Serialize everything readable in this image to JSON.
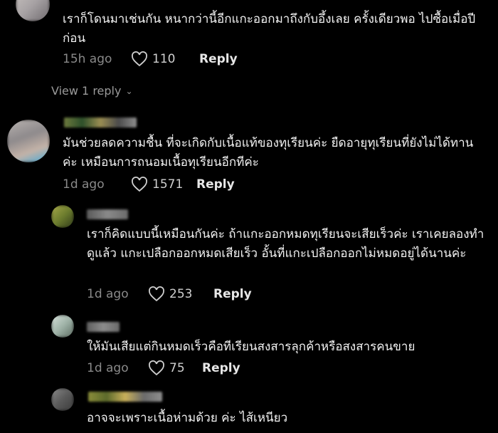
{
  "comments": [
    {
      "text": "เราก็โดนมาเช่นกัน หนากว่านี้อีกแกะออกมาถึงกับอึ้งเลย ครั้งเดียวพอ ไปซื้อเมื่อปีก่อน",
      "time": "15h ago",
      "likes": "110",
      "reply": "Reply"
    },
    {
      "text": "มันช่วยลดความชื้น ที่จะเกิดกับเนื้อแท้ของทุเรียนค่ะ ยืดอายุทุเรียนที่ยังไม่ได้ทาน ค่ะ เหมือนการถนอมเนื้อทุเรียนอีกทีค่ะ",
      "time": "1d ago",
      "likes": "1571",
      "reply": "Reply"
    },
    {
      "text": "เราก็คิดแบบนี้เหมือนกันค่ะ ถ้าแกะออกหมดทุเรียนจะเสียเร็วค่ะ เราเคยลองทำดูแล้ว แกะเปลือกออกหมดเสียเร็ว อั้นที่แกะเปลือกออกไม่หมดอยู่ได้นานค่ะ",
      "time": "1d ago",
      "likes": "253",
      "reply": "Reply"
    },
    {
      "text": "ให้มันเสียแต่กินหมดเร็วคือทีเรียนสงสารลุกค้าหรือสงสารคนขาย",
      "time": "1d ago",
      "likes": "75",
      "reply": "Reply"
    },
    {
      "text": "อาจจะเพราะเนื้อห่ามด้วย ค่ะ ไส้เหนียว"
    }
  ],
  "view_replies": "View 1 reply",
  "icons": {
    "like": "heart-outline-icon",
    "expand": "chevron-down-icon"
  },
  "colors": {
    "background": "#000000",
    "meta": "#8a8a8a",
    "text": "#f2f2f2"
  }
}
